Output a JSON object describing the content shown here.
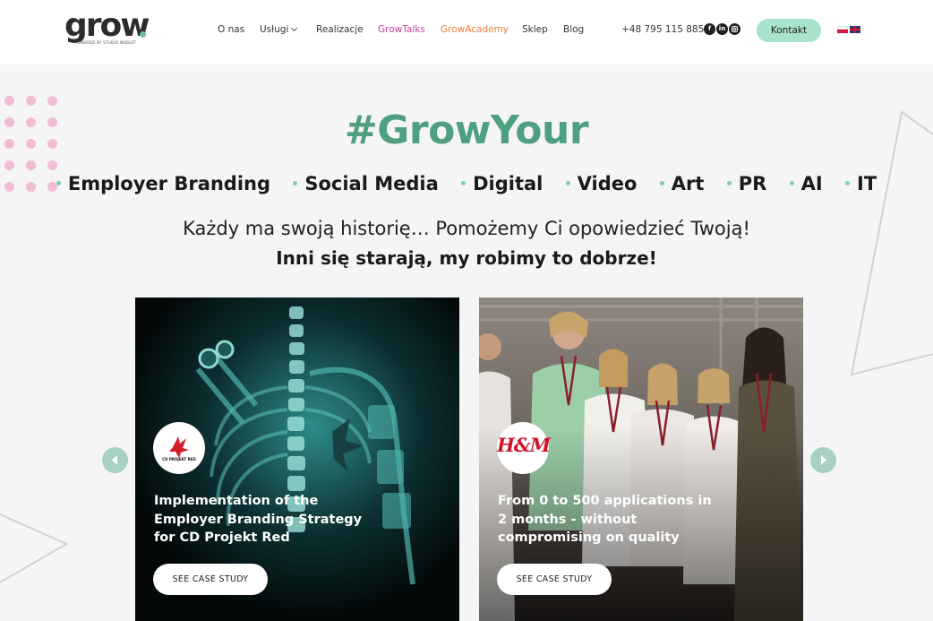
{
  "header": {
    "logo_text": "grow",
    "logo_sub": "POWERED BY STUDIO WIDGET",
    "nav": [
      {
        "label": "O nas"
      },
      {
        "label": "Usługi"
      },
      {
        "label": "Realizacje"
      },
      {
        "label": "GrowTalks"
      },
      {
        "label": "GrowAcademy"
      },
      {
        "label": "Sklep"
      },
      {
        "label": "Blog"
      }
    ],
    "phone": "+48 795 115 885",
    "social": [
      "facebook-icon",
      "linkedin-icon",
      "instagram-icon"
    ],
    "cta": "Kontakt",
    "languages": [
      "pl",
      "en"
    ]
  },
  "hero": {
    "hashtag": "#GrowYour",
    "services": [
      "Employer Branding",
      "Social Media",
      "Digital",
      "Video",
      "Art",
      "PR",
      "AI",
      "IT"
    ],
    "subtitle1": "Każdy ma swoją historię… Pomożemy Ci opowiedzieć Twoją!",
    "subtitle2": "Inni się starają, my robimy to dobrze!"
  },
  "cards": [
    {
      "logo_text": "CD PROJEKT RED",
      "title": "Implementation of the Employer Branding Strategy for CD Projekt Red",
      "button": "SEE CASE STUDY"
    },
    {
      "logo_text": "H&M",
      "title": "From 0 to 500 applications in 2 months - without compromising on quality",
      "button": "SEE CASE STUDY"
    }
  ],
  "colors": {
    "accent_green": "#4f9f81",
    "mint": "#a8e3cb",
    "talks": "#c73fa0",
    "academy": "#ec7d3d",
    "dots_pink": "#f2bcd4"
  }
}
